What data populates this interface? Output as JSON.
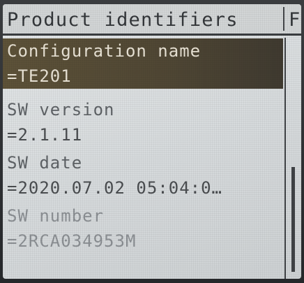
{
  "header": {
    "title": "Product identifiers",
    "next_tab_initial": "F"
  },
  "items": [
    {
      "label": "Configuration name",
      "value": "=TE201",
      "selected": true
    },
    {
      "label": "SW version",
      "value": "=2.1.11",
      "selected": false
    },
    {
      "label": "SW date",
      "value": "=2020.07.02 05:04:0…",
      "selected": false
    },
    {
      "label": "SW number",
      "value": "=2RCA034953M",
      "selected": false
    }
  ],
  "scrollbar": {
    "position_fraction": 0.55
  }
}
